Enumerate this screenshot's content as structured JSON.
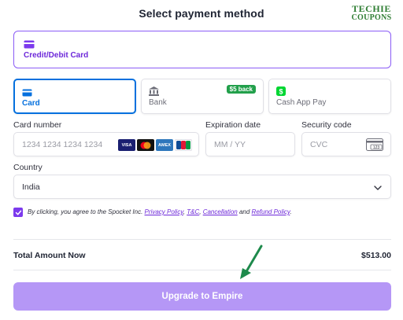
{
  "header": {
    "title": "Select payment method"
  },
  "logo": {
    "line1": "TECHIE",
    "line2": "COUPONS"
  },
  "method": {
    "label": "Credit/Debit Card"
  },
  "tabs": [
    {
      "label": "Card",
      "active": true
    },
    {
      "label": "Bank",
      "badge": "$5 back"
    },
    {
      "label": "Cash App Pay"
    }
  ],
  "form": {
    "card_number": {
      "label": "Card number",
      "placeholder": "1234 1234 1234 1234"
    },
    "card_brands": [
      "VISA",
      "mastercard",
      "AMEX",
      "JCB"
    ],
    "expiration": {
      "label": "Expiration date",
      "placeholder": "MM / YY"
    },
    "cvc": {
      "label": "Security code",
      "placeholder": "CVC",
      "card_hint": "123"
    },
    "country": {
      "label": "Country",
      "value": "India"
    }
  },
  "agreement": {
    "checked": true,
    "prefix": "By clicking, you agree to the Spocket Inc.",
    "privacy": "Privacy Policy",
    "comma": ",",
    "tnc": "T&C",
    "comma2": ",",
    "cancellation": "Cancellation",
    "and": "and",
    "refund": "Refund Policy",
    "period": "."
  },
  "summary": {
    "label": "Total Amount Now",
    "amount": "$513.00"
  },
  "cta": {
    "label": "Upgrade to Empire"
  },
  "colors": {
    "accent": "#8b5cf6",
    "tab_active": "#0570de",
    "cta": "#b597f6",
    "badge": "#22a04b",
    "arrow": "#1e8a4c"
  }
}
